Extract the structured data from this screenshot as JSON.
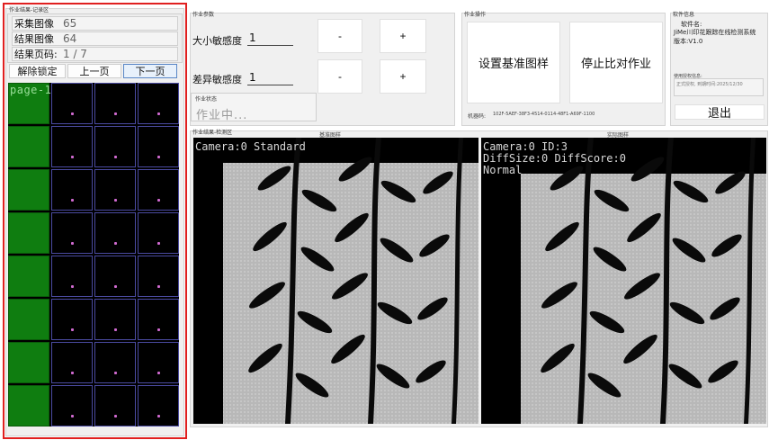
{
  "left_panel": {
    "group_title": "作业结果-记录区",
    "stats": [
      {
        "label": "采集图像",
        "value": "65"
      },
      {
        "label": "结果图像",
        "value": "64"
      },
      {
        "label": "结果页码:",
        "value": "1 / 7"
      }
    ],
    "buttons": {
      "unlock": "解除锁定",
      "prev": "上一页",
      "next": "下一页"
    },
    "grid_page_label": "page-1",
    "highlight_color": "#e02020"
  },
  "params": {
    "group_title": "作业参数",
    "size_label": "大小敏感度",
    "size_value": "1",
    "diff_label": "差异敏感度",
    "diff_value": "1",
    "minus": "-",
    "plus": "+",
    "status_title": "作业状态",
    "status_text": "作业中..."
  },
  "control": {
    "group_title": "作业操作",
    "set_ref_btn": "设置基准图样",
    "stop_btn": "停止比对作业",
    "machine_label": "机器码:",
    "machine_code": "102F-5AEF-38F3-4514-0114-48F1-A69F-1100"
  },
  "software": {
    "group_title": "软件信息",
    "name_label": "软件名:",
    "name_value": "JiMe川印花跟踪在线检测系统",
    "version": "版本:V1.0",
    "license_title": "使用授权信息:",
    "license_text": "正式授权, 到期时间:2025/12/30",
    "exit_btn": "退出"
  },
  "views": {
    "group_title": "作业结果-检测区",
    "reference": {
      "title": "基准图样",
      "overlay": "Camera:0 Standard"
    },
    "actual": {
      "title": "实际图样",
      "overlay": "Camera:0 ID:3\nDiffSize:0 DiffScore:0\nNormal"
    }
  }
}
